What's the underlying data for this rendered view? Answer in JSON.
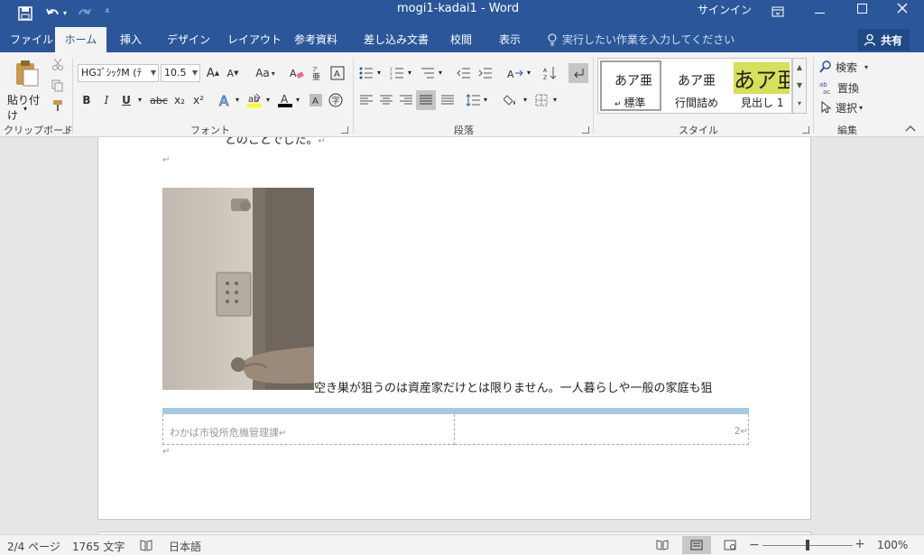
{
  "titlebar": {
    "doc_title": "mogi1-kadai1  -  Word",
    "signin": "サインイン",
    "icons": [
      "save-icon",
      "undo-icon",
      "redo-icon",
      "customize-icon",
      "ribbon-display-icon",
      "minimize-icon",
      "maximize-icon",
      "close-icon"
    ]
  },
  "tabs": {
    "file": "ファイル",
    "home": "ホーム",
    "insert": "挿入",
    "design": "デザイン",
    "layout": "レイアウト",
    "references": "参考資料",
    "mailings": "差し込み文書",
    "review": "校閲",
    "view": "表示",
    "tellme": "実行したい作業を入力してください",
    "share": "共有"
  },
  "ribbon": {
    "clipboard": {
      "label": "クリップボード",
      "paste": "貼り付け"
    },
    "font": {
      "label": "フォント",
      "font_name": "HGｺﾞｼｯｸM (ﾃ",
      "font_size": "10.5",
      "case_btn": "Aa",
      "bold": "B",
      "italic": "I",
      "underline": "U",
      "strike": "abc",
      "sub": "x₂",
      "sup": "x²"
    },
    "paragraph": {
      "label": "段落"
    },
    "styles": {
      "label": "スタイル",
      "items": [
        {
          "preview": "あア亜",
          "name": "標準"
        },
        {
          "preview": "あア亜",
          "name": "行間詰め"
        },
        {
          "preview": "あア亜",
          "name": "見出し 1"
        }
      ]
    },
    "editing": {
      "label": "編集",
      "find": "検索",
      "replace": "置換",
      "select": "選択"
    }
  },
  "document": {
    "line_top": "とのことでした。",
    "body_text": "空き巣が狙うのは資産家だけとは限りません。一人暮らしや一般の家庭も狙",
    "footer_left": "わかば市役所危機管理課",
    "footer_right": "2",
    "para_mark": "↵"
  },
  "status": {
    "page": "2/4 ページ",
    "words": "1765 文字",
    "language": "日本語",
    "zoom": "100%",
    "zoom_level": 0.5
  },
  "colors": {
    "accent": "#2b579a",
    "ribbon_bg": "#f3f3f3",
    "heading_highlight": "#d6e05a",
    "footer_table_band": "#a8c8e0"
  }
}
